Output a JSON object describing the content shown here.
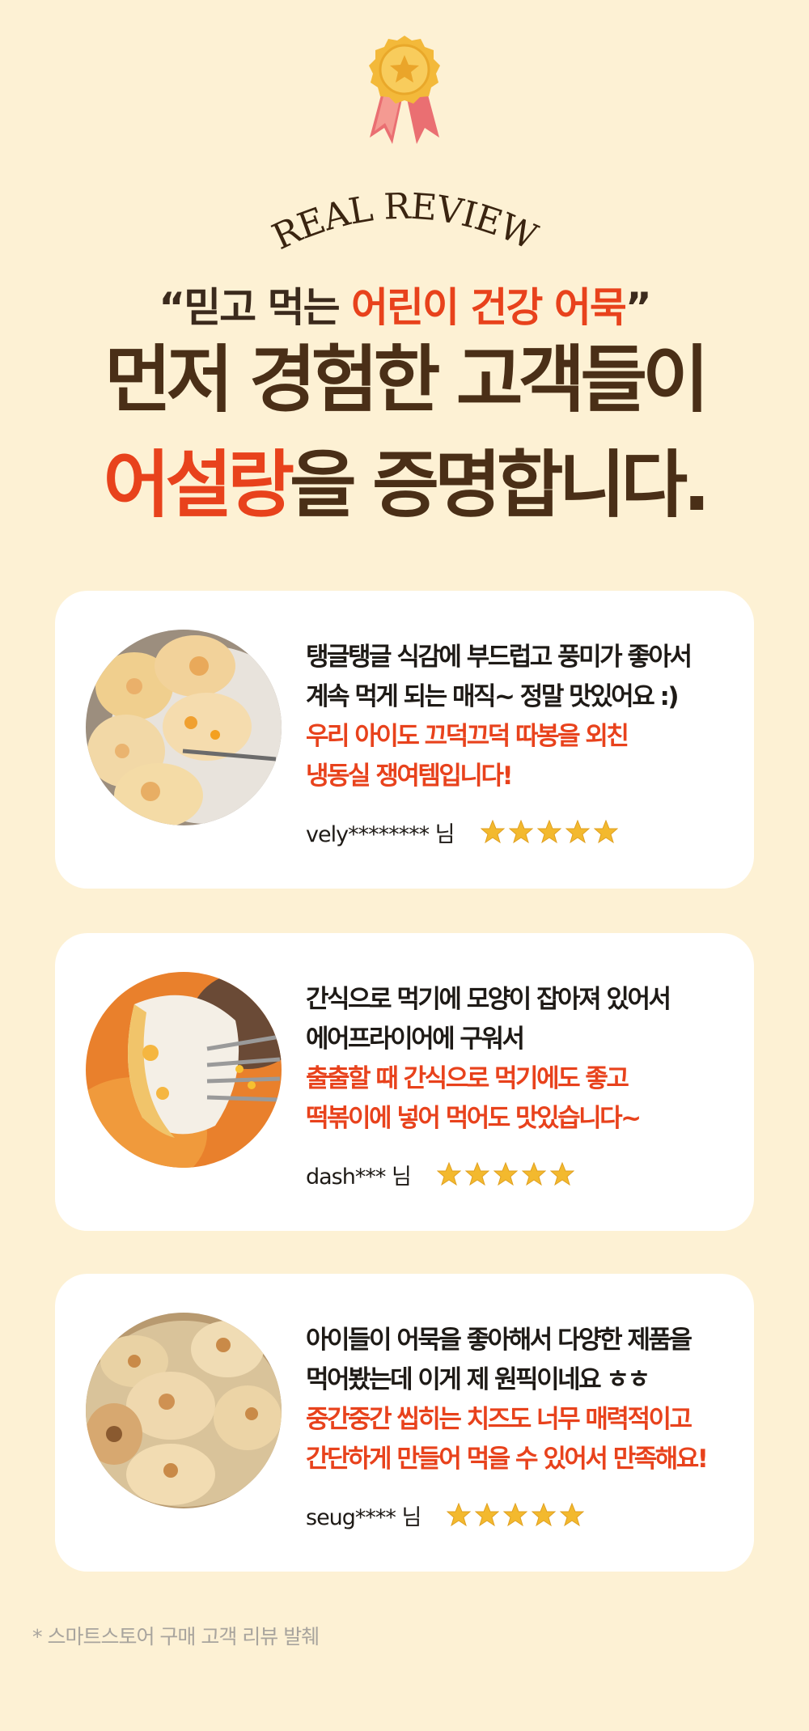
{
  "header": {
    "badge_icon": "medal-ribbon-icon",
    "arc_title": "REAL REVIEW",
    "quote_open": "“",
    "quote_plain": "믿고 먹는 ",
    "quote_highlight": "어린이 건강 어묵",
    "quote_close": "”",
    "headline_line1": "먼저 경험한 고객들이",
    "headline_highlight": "어설랑",
    "headline_line2_rest": "을 증명합니다."
  },
  "colors": {
    "background": "#fdf1d4",
    "accent": "#e8421c",
    "heading": "#4a2f17",
    "card": "#ffffff",
    "star": "#f3b92e"
  },
  "reviews": [
    {
      "photo": "fish-cake-patties-photo",
      "lines_black": [
        "탱글탱글 식감에 부드럽고 풍미가 좋아서",
        "계속 먹게 되는 매직~ 정말 맛있어요 :)"
      ],
      "lines_red": [
        "우리 아이도 끄덕끄덕 따봉을 외친",
        "냉동실 쟁여템입니다!"
      ],
      "author": "vely******** 님",
      "rating": 5
    },
    {
      "photo": "fish-cake-in-sauce-photo",
      "lines_black": [
        "간식으로 먹기에 모양이 잡아져 있어서",
        "에어프라이어에 구워서"
      ],
      "lines_red": [
        "출출할 때 간식으로 먹기에도 좋고",
        "떡볶이에 넣어 먹어도 맛있습니다~"
      ],
      "author": "dash*** 님",
      "rating": 5
    },
    {
      "photo": "grilled-fish-cakes-plate-photo",
      "lines_black": [
        "아이들이 어묵을 좋아해서 다양한 제품을",
        "먹어봤는데 이게 제 원픽이네요 ㅎㅎ"
      ],
      "lines_red": [
        "중간중간 씹히는 치즈도 너무 매력적이고",
        "간단하게 만들어 먹을 수 있어서 만족해요!"
      ],
      "author": "seug**** 님",
      "rating": 5
    }
  ],
  "footnote": "* 스마트스토어 구매 고객 리뷰 발췌"
}
